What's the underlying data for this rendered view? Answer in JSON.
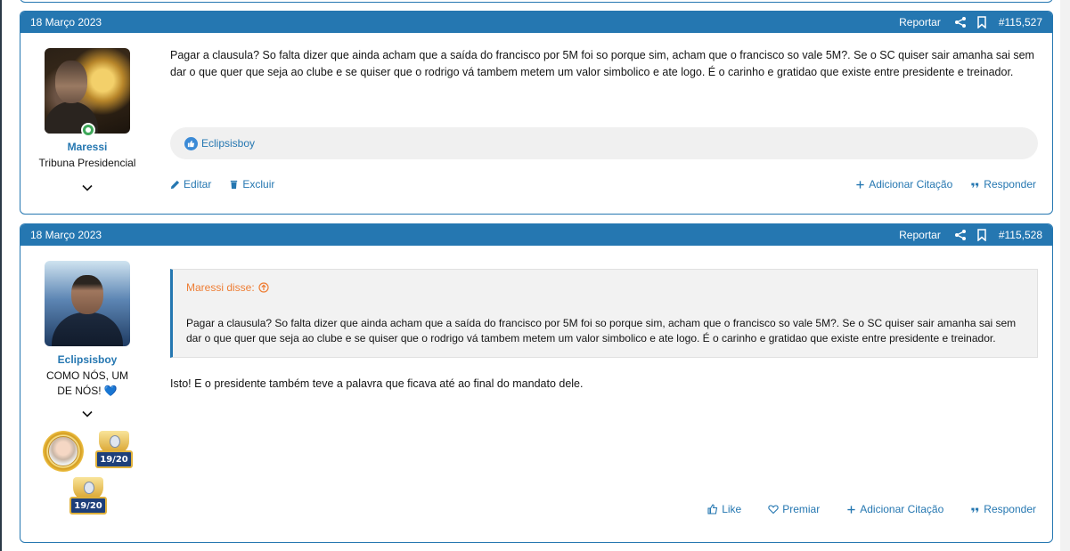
{
  "posts": [
    {
      "date": "18 Março 2023",
      "report_label": "Reportar",
      "post_number": "#115,527",
      "user": {
        "name": "Maressi",
        "title": "Tribuna Presidencial"
      },
      "message": "Pagar a clausula? So falta dizer que ainda acham que a saída do francisco por 5M foi so porque sim, acham que o francisco so vale 5M?. Se o SC quiser sair amanha sai sem dar o que quer que seja ao clube e se quiser que o rodrigo vá tambem metem um valor simbolico e ate logo. É o carinho e gratidao que existe entre presidente e treinador.",
      "reactions": "Eclipsisboy",
      "actions_left": [
        "Editar",
        "Excluir"
      ],
      "actions_right": [
        "Adicionar Citação",
        "Responder"
      ]
    },
    {
      "date": "18 Março 2023",
      "report_label": "Reportar",
      "post_number": "#115,528",
      "user": {
        "name": "Eclipsisboy",
        "title": "COMO NÓS, UM DE NÓS! 💙"
      },
      "quote": {
        "author": "Maressi disse:",
        "text": "Pagar a clausula? So falta dizer que ainda acham que a saída do francisco por 5M foi so porque sim, acham que o francisco so vale 5M?. Se o SC quiser sair amanha sai sem dar o que quer que seja ao clube e se quiser que o rodrigo vá tambem metem um valor simbolico e ate logo. É o carinho e gratidao que existe entre presidente e treinador."
      },
      "message": "Isto! E o presidente também teve a palavra que ficava até ao final do mandato dele.",
      "trophy_label": "19/20",
      "actions_right": [
        "Like",
        "Premiar",
        "Adicionar Citação",
        "Responder"
      ]
    }
  ],
  "colors": {
    "accent": "#2577b1",
    "quote_author": "#ee7d34",
    "online": "#3fa85a"
  }
}
